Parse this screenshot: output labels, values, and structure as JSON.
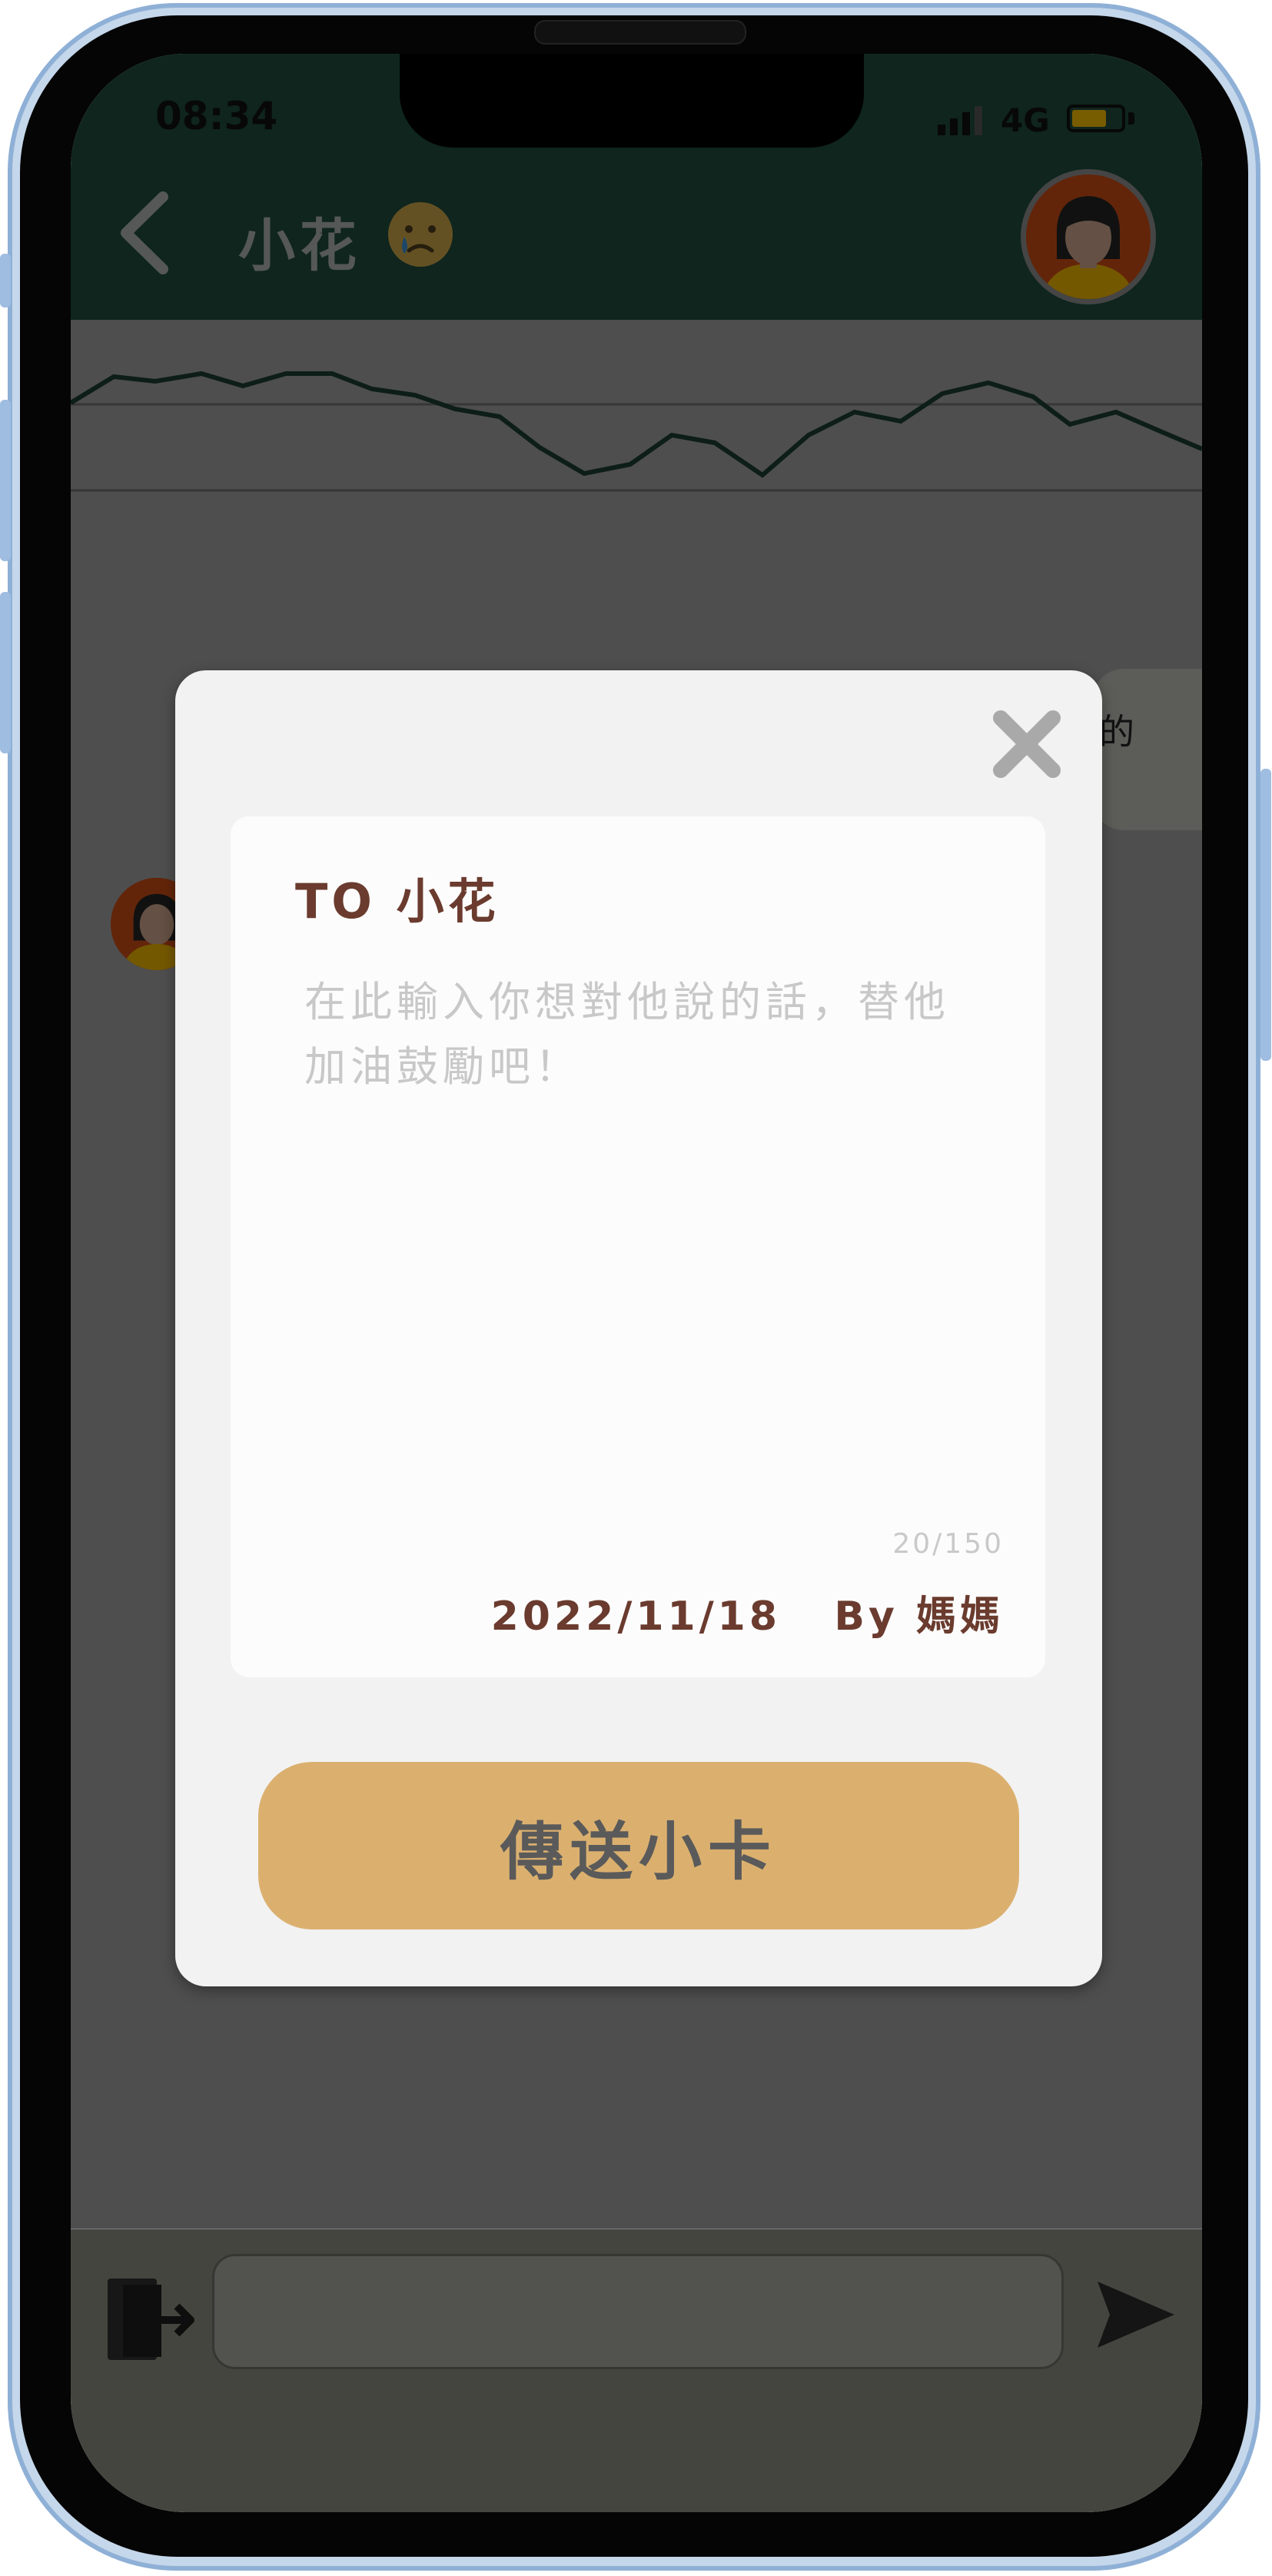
{
  "status_bar": {
    "time": "08:34",
    "network": "4G"
  },
  "header": {
    "title": "小花",
    "mood_icon": "crying-face-icon",
    "back_icon": "chevron-left-icon",
    "avatar": "girl-avatar"
  },
  "chat": {
    "bubble_partial_text": "的"
  },
  "input_bar": {
    "exit_icon": "exit-door-icon",
    "send_icon": "send-arrow-icon",
    "value": ""
  },
  "modal": {
    "close_icon": "close-x-icon",
    "to_label": "TO 小花",
    "message_placeholder": "在此輸入你想對他說的話，替他加油鼓勵吧！",
    "message_value": "",
    "char_count": "20/150",
    "footer": "2022/11/18   By 媽媽",
    "send_button_label": "傳送小卡"
  },
  "colors": {
    "header_bg": "#1f4a3d",
    "button_bg": "#dbb06f",
    "text_brown": "#6a3b2e",
    "modal_bg": "#f2f2f2"
  }
}
